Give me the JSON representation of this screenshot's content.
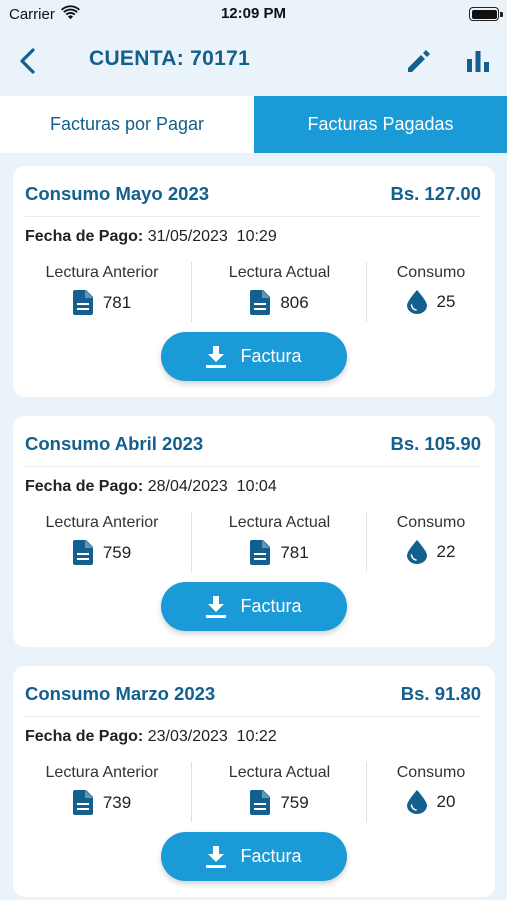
{
  "status_bar": {
    "carrier": "Carrier",
    "time": "12:09 PM"
  },
  "nav": {
    "title": "CUENTA: 70171"
  },
  "tabs": [
    {
      "label": "Facturas por Pagar",
      "selected": false
    },
    {
      "label": "Facturas Pagadas",
      "selected": true
    }
  ],
  "labels": {
    "pay_date": "Fecha de Pago:",
    "prev_reading": "Lectura Anterior",
    "curr_reading": "Lectura Actual",
    "consumption": "Consumo",
    "invoice_button": "Factura"
  },
  "bills": [
    {
      "title": "Consumo Mayo 2023",
      "amount": "Bs. 127.00",
      "date": "31/05/2023",
      "time": "10:29",
      "prev": "781",
      "curr": "806",
      "consumption": "25"
    },
    {
      "title": "Consumo Abril 2023",
      "amount": "Bs. 105.90",
      "date": "28/04/2023",
      "time": "10:04",
      "prev": "759",
      "curr": "781",
      "consumption": "22"
    },
    {
      "title": "Consumo Marzo 2023",
      "amount": "Bs. 91.80",
      "date": "23/03/2023",
      "time": "10:22",
      "prev": "739",
      "curr": "759",
      "consumption": "20"
    }
  ],
  "colors": {
    "primary": "#135f8d",
    "accent": "#1a9ad6",
    "background": "#e9f3f9"
  },
  "icons": {
    "back": "chevron-left-icon",
    "edit": "pencil-icon",
    "chart": "bar-chart-icon",
    "document": "document-icon",
    "water": "water-drop-icon",
    "download": "download-icon"
  }
}
